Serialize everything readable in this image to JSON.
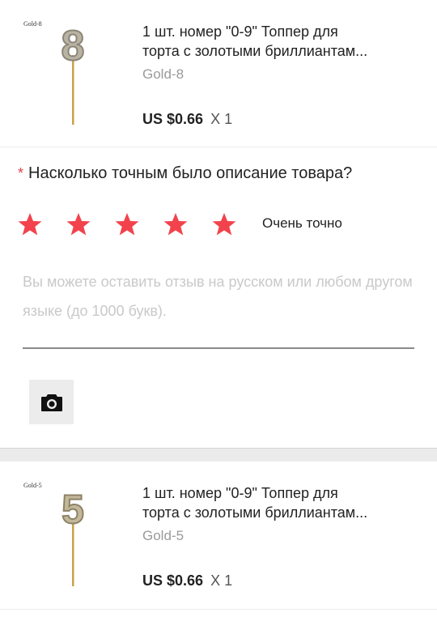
{
  "products": [
    {
      "thumb_label": "Gold-8",
      "digit": "8",
      "title_line1": "1 шт. номер \"0-9\" Топпер для",
      "title_line2": "торта с золотыми бриллиантам...",
      "variant": "Gold-8",
      "price": "US $0.66",
      "qty": "X 1"
    },
    {
      "thumb_label": "Gold-5",
      "digit": "5",
      "title_line1": "1 шт. номер \"0-9\" Топпер для",
      "title_line2": "торта с золотыми бриллиантам...",
      "variant": "Gold-5",
      "price": "US $0.66",
      "qty": "X 1"
    }
  ],
  "rating": {
    "required_mark": "*",
    "question": "Насколько точным было описание товара?",
    "stars_selected": 5,
    "stars_total": 5,
    "label": "Очень точно",
    "star_color": "#f2434d"
  },
  "review": {
    "placeholder": "Вы можете оставить отзыв на русском или любом другом языке (до 1000 букв)."
  },
  "camera_button": {
    "icon": "camera-icon"
  }
}
